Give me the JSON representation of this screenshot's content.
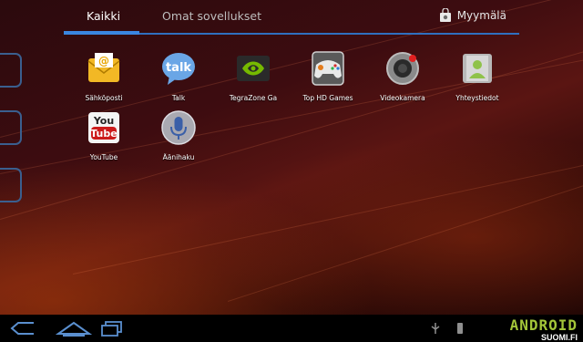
{
  "tabs": [
    {
      "label": "Kaikki",
      "active": true
    },
    {
      "label": "Omat sovellukset",
      "active": false
    }
  ],
  "store": {
    "label": "Myymälä",
    "icon": "shopping-bag-icon"
  },
  "apps": [
    {
      "name": "email-app",
      "label": "Sähköposti",
      "icon": "email-icon"
    },
    {
      "name": "talk-app",
      "label": "Talk",
      "icon": "talk-icon",
      "icon_text": "talk"
    },
    {
      "name": "tegrazone-app",
      "label": "TegraZone Ga",
      "icon": "nvidia-icon"
    },
    {
      "name": "top-hd-games-app",
      "label": "Top HD Games",
      "icon": "gamepad-icon"
    },
    {
      "name": "videokamera-app",
      "label": "Videokamera",
      "icon": "camera-icon"
    },
    {
      "name": "yhteystiedot-app",
      "label": "Yhteystiedot",
      "icon": "contacts-icon"
    },
    {
      "name": "youtube-app",
      "label": "YouTube",
      "icon": "youtube-icon",
      "icon_text_top": "You",
      "icon_text_bottom": "Tube"
    },
    {
      "name": "voice-search-app",
      "label": "Äänihaku",
      "icon": "microphone-icon"
    }
  ],
  "email_icon_text": "@",
  "navigation": {
    "back": "back-icon",
    "home": "home-icon",
    "recent": "recent-apps-icon"
  },
  "watermark": {
    "main": "ANDROID",
    "sub": "SUOMI.FI"
  },
  "colors": {
    "accent": "#3a86e0",
    "android_green": "#a4c639"
  }
}
